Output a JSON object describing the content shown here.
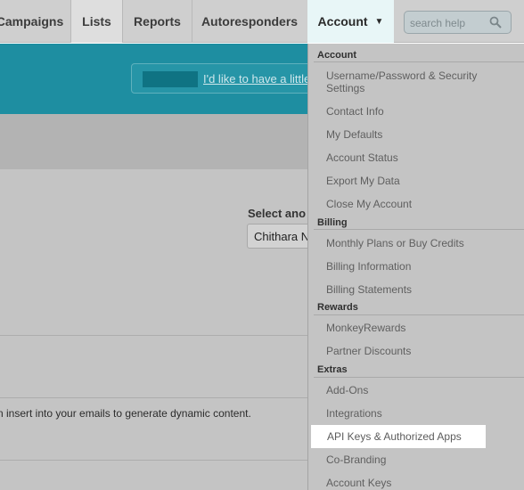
{
  "nav": {
    "campaigns": "Campaigns",
    "lists": "Lists",
    "reports": "Reports",
    "autoresponders": "Autoresponders",
    "account": "Account",
    "account_caret": "▼"
  },
  "search": {
    "placeholder": "search help"
  },
  "banner": {
    "link_text": "I'd like to have a little"
  },
  "main": {
    "select_label": "Select ano",
    "select_value": "Chithara N",
    "merge_text": "n insert into your emails to generate dynamic content."
  },
  "dropdown": {
    "sections": {
      "account": "Account",
      "billing": "Billing",
      "rewards": "Rewards",
      "extras": "Extras"
    },
    "items": {
      "username_password": "Username/Password & Security Settings",
      "contact_info": "Contact Info",
      "my_defaults": "My Defaults",
      "account_status": "Account Status",
      "export_my_data": "Export My Data",
      "close_my_account": "Close My Account",
      "monthly_plans": "Monthly Plans or Buy Credits",
      "billing_information": "Billing Information",
      "billing_statements": "Billing Statements",
      "monkey_rewards": "MonkeyRewards",
      "partner_discounts": "Partner Discounts",
      "add_ons": "Add-Ons",
      "integrations": "Integrations",
      "api_keys": "API Keys & Authorized Apps",
      "co_branding": "Co-Branding",
      "account_keys": "Account Keys"
    },
    "highlighted_item": "API Keys & Authorized Apps"
  },
  "colors": {
    "banner": "#1e8ea1",
    "active_tab": "#e8f6f7",
    "highlight": "#ffffff"
  }
}
